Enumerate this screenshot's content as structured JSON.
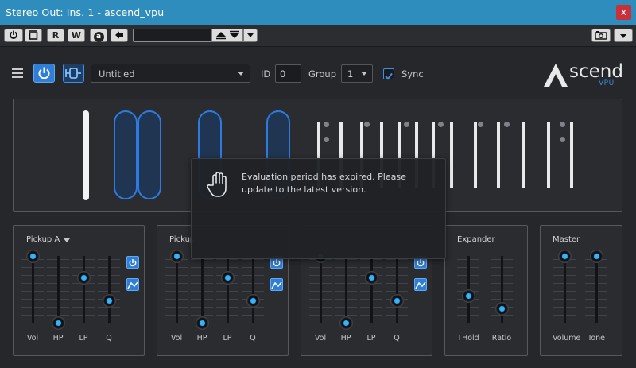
{
  "window": {
    "title": "Stereo Out: Ins. 1 - ascend_vpu",
    "close_label": "x"
  },
  "host_toolbar": {
    "read_label": "R",
    "write_label": "W",
    "compare_label": "a",
    "preset_value": ""
  },
  "plugin": {
    "preset_name": "Untitled",
    "id_label": "ID",
    "id_value": "0",
    "group_label": "Group",
    "group_value": "1",
    "sync_label": "Sync",
    "sync_checked": true,
    "logo_word": "scend",
    "logo_sub": "VPU"
  },
  "overlay": {
    "message": "Evaluation period has expired. Please update to the latest version."
  },
  "modules": [
    {
      "title": "Pickup A",
      "has_dropdown": true,
      "sliders": [
        {
          "label": "Vol",
          "value": 1.0
        },
        {
          "label": "HP",
          "value": 0.0
        },
        {
          "label": "LP",
          "value": 0.68
        },
        {
          "label": "Q",
          "value": 0.33
        }
      ]
    },
    {
      "title": "Pickup",
      "has_dropdown": false,
      "sliders": [
        {
          "label": "Vol",
          "value": 1.0
        },
        {
          "label": "HP",
          "value": 0.0
        },
        {
          "label": "LP",
          "value": 0.68
        },
        {
          "label": "Q",
          "value": 0.33
        }
      ]
    },
    {
      "title": "",
      "has_dropdown": false,
      "sliders": [
        {
          "label": "Vol",
          "value": 1.0
        },
        {
          "label": "HP",
          "value": 0.0
        },
        {
          "label": "LP",
          "value": 0.68
        },
        {
          "label": "Q",
          "value": 0.33
        }
      ]
    },
    {
      "title": "Expander",
      "has_dropdown": false,
      "sliders": [
        {
          "label": "THold",
          "value": 0.4
        },
        {
          "label": "Ratio",
          "value": 0.22
        }
      ]
    },
    {
      "title": "Master",
      "has_dropdown": false,
      "sliders": [
        {
          "label": "Volume",
          "value": 1.0
        },
        {
          "label": "Tone",
          "value": 1.0
        }
      ]
    }
  ]
}
